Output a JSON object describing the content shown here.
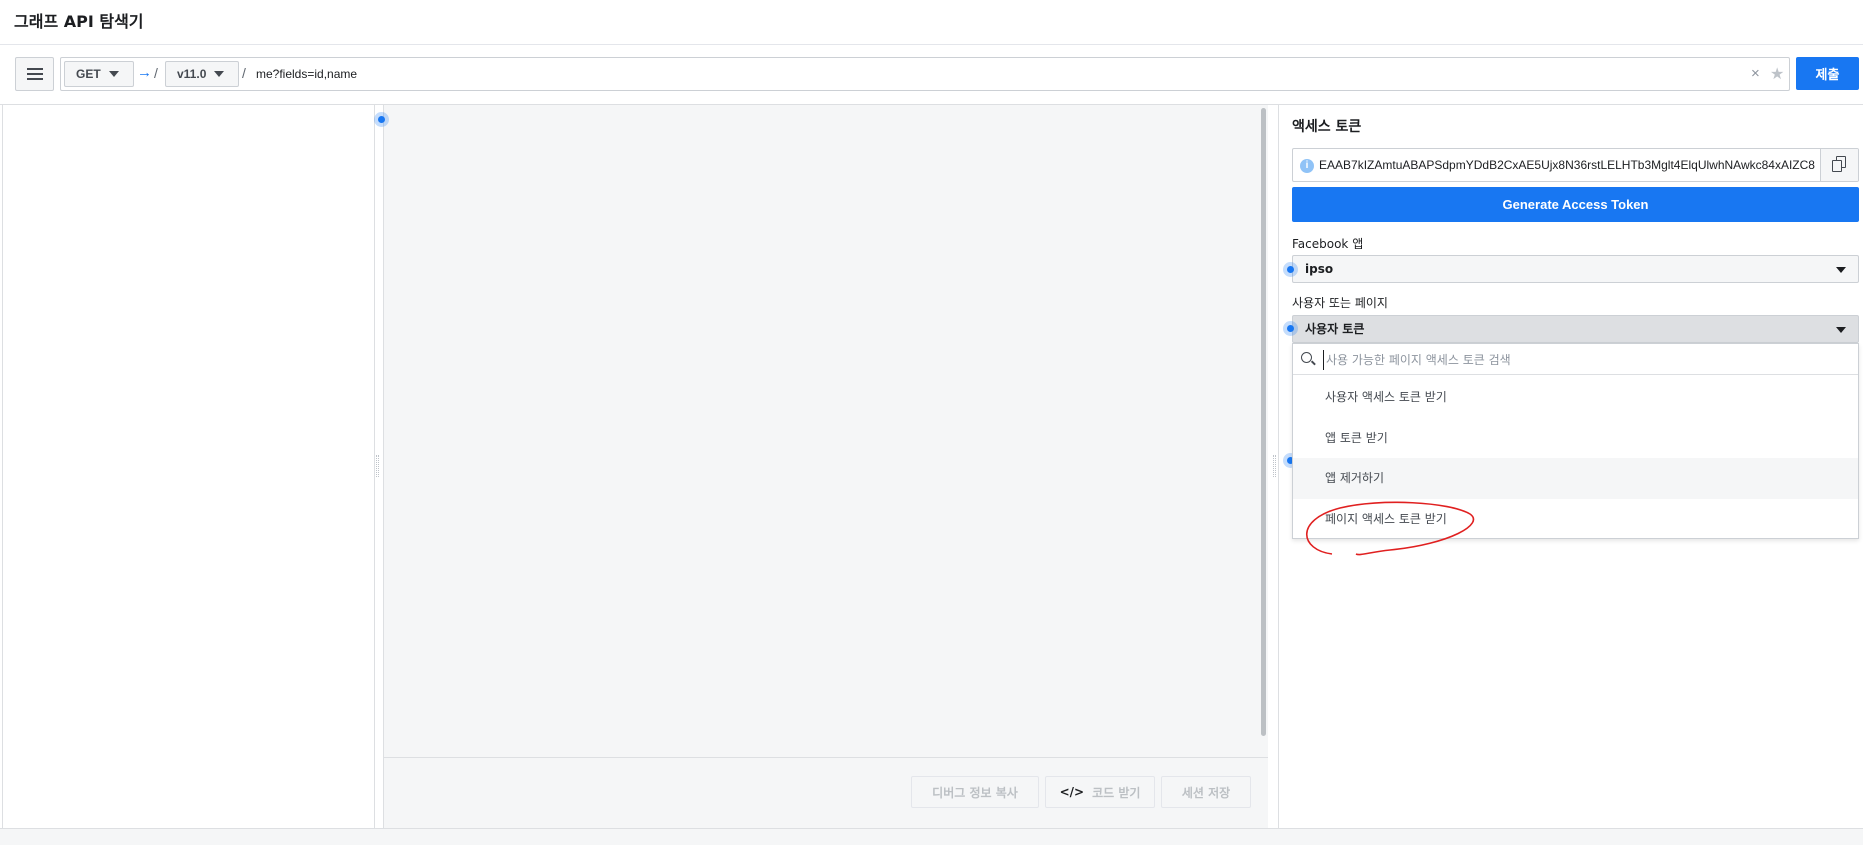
{
  "header": {
    "title": "그래프 API 탐색기"
  },
  "request": {
    "method": "GET",
    "arrow": "→",
    "slash": "/",
    "version": "v11.0",
    "path": "me?fields=id,name",
    "clear": "×",
    "star": "★",
    "submit_label": "제출"
  },
  "result_footer": {
    "copy_debug_label": "디버그 정보 복사",
    "get_code_icon": "</>",
    "get_code_label": "코드 받기",
    "save_session_label": "세션 저장"
  },
  "access_panel": {
    "title": "액세스 토큰",
    "token": "EAAB7kIZAmtuABAPSdpmYDdB2CxAE5Ujx8N36rstLELHTb3Mglt4ElqUlwhNAwkc84xAIZC8",
    "info_icon": "i",
    "generate_label": "Generate Access Token",
    "app_label": "Facebook 앱",
    "app_value": "ipso",
    "user_page_label": "사용자 또는 페이지",
    "user_page_value": "사용자 토큰",
    "search_placeholder": "사용 가능한 페이지 액세스 토큰 검색",
    "options": [
      {
        "label": "사용자 액세스 토큰 받기"
      },
      {
        "label": "앱 토큰 받기"
      },
      {
        "label": "앱 제거하기"
      },
      {
        "label": "페이지 액세스 토큰 받기"
      }
    ]
  },
  "colors": {
    "accent": "#1877f2",
    "annotation": "#e02020"
  },
  "icons": {
    "menu": "hamburger-icon",
    "search": "search-icon",
    "copy": "copy-icon",
    "info": "info-icon",
    "star": "star-icon"
  }
}
